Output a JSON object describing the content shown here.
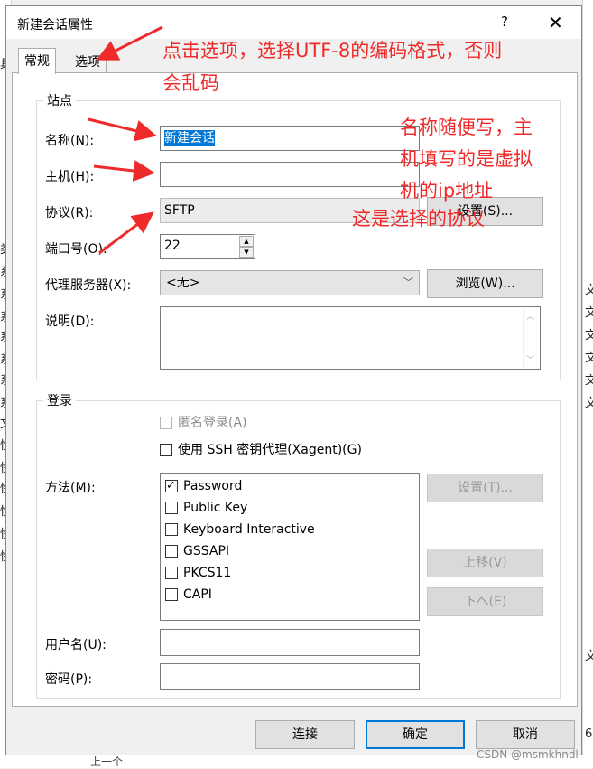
{
  "background": {
    "left_chars": [
      "具",
      "类",
      "系",
      "系",
      "系",
      "系",
      "系",
      "系",
      "系",
      "文",
      "快",
      "快",
      "快",
      "快",
      "快",
      "快"
    ],
    "right_chars": [
      "文",
      "文",
      "文",
      "文",
      "文",
      "文",
      "文",
      "6"
    ],
    "bottom_text": "上一个"
  },
  "dialog": {
    "title": "新建会话属性",
    "help": "?",
    "close": "✕",
    "tabs": [
      {
        "label": "常规"
      },
      {
        "label": "选项"
      }
    ]
  },
  "site": {
    "group_label": "站点",
    "name_label": "名称(N):",
    "name_value": "新建会话",
    "host_label": "主机(H):",
    "host_value": "",
    "protocol_label": "协议(R):",
    "protocol_value": "SFTP",
    "settings_label": "设置(S)...",
    "port_label": "端口号(O):",
    "port_value": "22",
    "proxy_label": "代理服务器(X):",
    "proxy_value": "<无>",
    "browse_label": "浏览(W)...",
    "desc_label": "说明(D):"
  },
  "login": {
    "group_label": "登录",
    "anonymous": "匿名登录(A)",
    "ssh_agent": "使用 SSH 密钥代理(Xagent)(G)",
    "method_label": "方法(M):",
    "methods": [
      {
        "label": "Password",
        "checked": true
      },
      {
        "label": "Public Key",
        "checked": false
      },
      {
        "label": "Keyboard Interactive",
        "checked": false
      },
      {
        "label": "GSSAPI",
        "checked": false
      },
      {
        "label": "PKCS11",
        "checked": false
      },
      {
        "label": "CAPI",
        "checked": false
      }
    ],
    "method_settings": "设置(T)...",
    "move_up": "上移(V)",
    "move_down": "下へ(E)",
    "username_label": "用户名(U):",
    "password_label": "密码(P):"
  },
  "footer": {
    "connect": "连接",
    "ok": "确定",
    "cancel": "取消"
  },
  "annotations": {
    "options_note_line1": "点击选项，选择UTF-8的编码格式，否则",
    "options_note_line2": "会乱码",
    "name_note_line1": "名称随便写，主",
    "name_note_line2": "机填写的是虚拟",
    "name_note_line3": "机的ip地址",
    "protocol_note": "这是选择的协议",
    "color": "#ef2a2a"
  },
  "watermark": "CSDN @msmkhndl"
}
